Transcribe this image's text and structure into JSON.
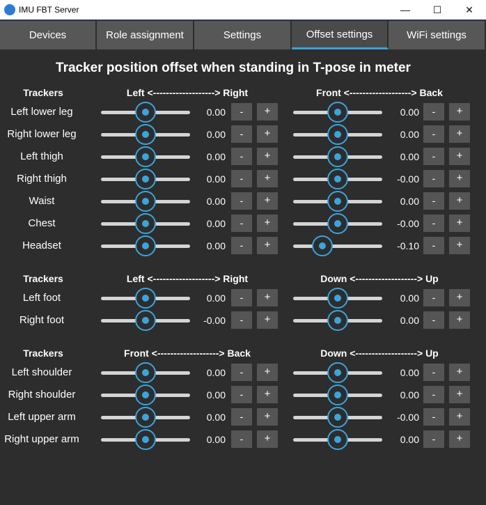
{
  "window": {
    "title": "IMU FBT Server",
    "minimize": "—",
    "maximize": "☐",
    "close": "✕"
  },
  "tabs": [
    {
      "label": "Devices",
      "active": false
    },
    {
      "label": "Role assignment",
      "active": false
    },
    {
      "label": "Settings",
      "active": false
    },
    {
      "label": "Offset settings",
      "active": true
    },
    {
      "label": "WiFi settings",
      "active": false
    }
  ],
  "heading": "Tracker position offset when standing in T-pose in meter",
  "buttons": {
    "minus": "-",
    "plus": "+"
  },
  "colors": {
    "accent": "#3aa5dd",
    "background": "#2d2d2d",
    "button": "#555555"
  },
  "sections": [
    {
      "col0": "Trackers",
      "col1": "Left <-------------------> Right",
      "col2": "Front <-------------------> Back",
      "rows": [
        {
          "label": "Left lower leg",
          "v1": "0.00",
          "p1": 0.5,
          "v2": "0.00",
          "p2": 0.5
        },
        {
          "label": "Right lower leg",
          "v1": "0.00",
          "p1": 0.5,
          "v2": "0.00",
          "p2": 0.5
        },
        {
          "label": "Left thigh",
          "v1": "0.00",
          "p1": 0.5,
          "v2": "0.00",
          "p2": 0.5
        },
        {
          "label": "Right thigh",
          "v1": "0.00",
          "p1": 0.5,
          "v2": "-0.00",
          "p2": 0.5
        },
        {
          "label": "Waist",
          "v1": "0.00",
          "p1": 0.5,
          "v2": "0.00",
          "p2": 0.5
        },
        {
          "label": "Chest",
          "v1": "0.00",
          "p1": 0.5,
          "v2": "-0.00",
          "p2": 0.5
        },
        {
          "label": "Headset",
          "v1": "0.00",
          "p1": 0.5,
          "v2": "-0.10",
          "p2": 0.33
        }
      ]
    },
    {
      "col0": "Trackers",
      "col1": "Left <-------------------> Right",
      "col2": "Down <-------------------> Up",
      "rows": [
        {
          "label": "Left foot",
          "v1": "0.00",
          "p1": 0.5,
          "v2": "0.00",
          "p2": 0.5
        },
        {
          "label": "Right foot",
          "v1": "-0.00",
          "p1": 0.5,
          "v2": "0.00",
          "p2": 0.5
        }
      ]
    },
    {
      "col0": "Trackers",
      "col1": "Front <-------------------> Back",
      "col2": "Down <-------------------> Up",
      "rows": [
        {
          "label": "Left shoulder",
          "v1": "0.00",
          "p1": 0.5,
          "v2": "0.00",
          "p2": 0.5
        },
        {
          "label": "Right shoulder",
          "v1": "0.00",
          "p1": 0.5,
          "v2": "0.00",
          "p2": 0.5
        },
        {
          "label": "Left upper arm",
          "v1": "0.00",
          "p1": 0.5,
          "v2": "-0.00",
          "p2": 0.5
        },
        {
          "label": "Right upper arm",
          "v1": "0.00",
          "p1": 0.5,
          "v2": "0.00",
          "p2": 0.5
        }
      ]
    }
  ]
}
